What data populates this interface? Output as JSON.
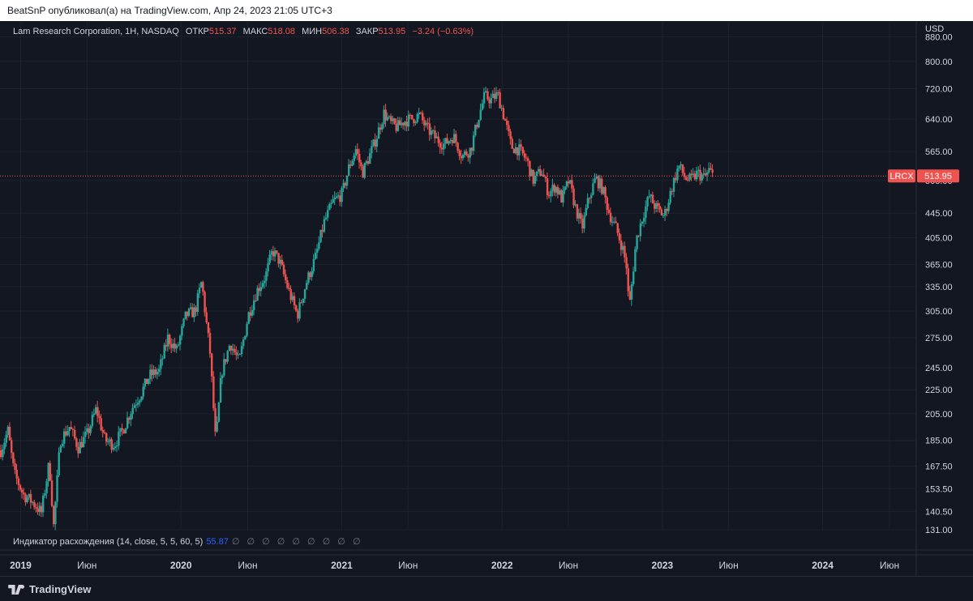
{
  "header": {
    "publisher_text": "BeatSnP опубликовал(а) на TradingView.com, Апр 24, 2023 21:05 UTC+3"
  },
  "legend": {
    "title": "Lam Research Corporation, 1H, NASDAQ",
    "open_label": "ОТКР",
    "open_value": "515.37",
    "high_label": "МАКС",
    "high_value": "518.08",
    "low_label": "МИН",
    "low_value": "506.38",
    "close_label": "ЗАКР",
    "close_value": "513.95",
    "change": "−3.24 (−0.63%)"
  },
  "indicator": {
    "label": "Индикатор расхождения (14, close, 5, 5, 60, 5)",
    "value": "55.87",
    "empty_values": "∅ ∅ ∅ ∅ ∅ ∅ ∅ ∅ ∅"
  },
  "price_scale": {
    "currency": "USD"
  },
  "footer": {
    "brand": "TradingView"
  },
  "colors": {
    "up": "#26a69a",
    "down": "#ef5350",
    "background": "#131722",
    "grid": "#1e222d",
    "price_line": "#f0524f",
    "text": "#d1d4dc"
  },
  "chart_data": {
    "type": "candlestick",
    "symbol": "LRCX",
    "y_scale": "log",
    "ylim": [
      131,
      935
    ],
    "x_range": [
      "2018-11-15",
      "2024-08-01"
    ],
    "y_ticks": [
      "880.00",
      "800.00",
      "720.00",
      "640.00",
      "565.00",
      "505.00",
      "445.00",
      "405.00",
      "365.00",
      "335.00",
      "305.00",
      "275.00",
      "245.00",
      "225.00",
      "205.00",
      "185.00",
      "167.50",
      "153.50",
      "140.50",
      "131.00"
    ],
    "x_ticks": [
      {
        "date": "2019-01-01",
        "label": "2019",
        "bold": true
      },
      {
        "date": "2019-06-01",
        "label": "Июн",
        "bold": false
      },
      {
        "date": "2020-01-01",
        "label": "2020",
        "bold": true
      },
      {
        "date": "2020-06-01",
        "label": "Июн",
        "bold": false
      },
      {
        "date": "2021-01-01",
        "label": "2021",
        "bold": true
      },
      {
        "date": "2021-06-01",
        "label": "Июн",
        "bold": false
      },
      {
        "date": "2022-01-01",
        "label": "2022",
        "bold": true
      },
      {
        "date": "2022-06-01",
        "label": "Июн",
        "bold": false
      },
      {
        "date": "2023-01-01",
        "label": "2023",
        "bold": true
      },
      {
        "date": "2023-06-01",
        "label": "Июн",
        "bold": false
      },
      {
        "date": "2024-01-01",
        "label": "2024",
        "bold": true
      },
      {
        "date": "2024-06-01",
        "label": "Июн",
        "bold": false
      }
    ],
    "last_price": {
      "label": "LRCX",
      "value": 513.95
    },
    "close_path": [
      [
        "2018-11-15",
        178
      ],
      [
        "2018-12-01",
        192
      ],
      [
        "2018-12-15",
        163
      ],
      [
        "2019-01-05",
        150
      ],
      [
        "2019-01-25",
        146
      ],
      [
        "2019-02-15",
        140
      ],
      [
        "2019-03-05",
        170
      ],
      [
        "2019-03-15",
        133
      ],
      [
        "2019-03-30",
        185
      ],
      [
        "2019-04-20",
        195
      ],
      [
        "2019-05-10",
        180
      ],
      [
        "2019-05-31",
        190
      ],
      [
        "2019-06-20",
        209
      ],
      [
        "2019-07-10",
        185
      ],
      [
        "2019-07-31",
        182
      ],
      [
        "2019-08-20",
        193
      ],
      [
        "2019-09-10",
        210
      ],
      [
        "2019-09-30",
        222
      ],
      [
        "2019-10-20",
        238
      ],
      [
        "2019-11-10",
        242
      ],
      [
        "2019-11-30",
        275
      ],
      [
        "2019-12-20",
        262
      ],
      [
        "2020-01-10",
        300
      ],
      [
        "2020-01-31",
        305
      ],
      [
        "2020-02-15",
        342
      ],
      [
        "2020-02-24",
        298
      ],
      [
        "2020-03-05",
        260
      ],
      [
        "2020-03-18",
        183
      ],
      [
        "2020-03-31",
        240
      ],
      [
        "2020-04-20",
        270
      ],
      [
        "2020-05-10",
        250
      ],
      [
        "2020-05-31",
        300
      ],
      [
        "2020-06-20",
        330
      ],
      [
        "2020-07-10",
        350
      ],
      [
        "2020-07-25",
        385
      ],
      [
        "2020-08-10",
        370
      ],
      [
        "2020-08-31",
        330
      ],
      [
        "2020-09-20",
        300
      ],
      [
        "2020-10-10",
        340
      ],
      [
        "2020-10-31",
        375
      ],
      [
        "2020-11-20",
        430
      ],
      [
        "2020-12-10",
        465
      ],
      [
        "2020-12-31",
        480
      ],
      [
        "2021-01-15",
        530
      ],
      [
        "2021-01-31",
        570
      ],
      [
        "2021-02-15",
        520
      ],
      [
        "2021-03-05",
        560
      ],
      [
        "2021-03-20",
        600
      ],
      [
        "2021-04-05",
        655
      ],
      [
        "2021-04-20",
        630
      ],
      [
        "2021-05-05",
        620
      ],
      [
        "2021-05-20",
        635
      ],
      [
        "2021-06-05",
        640
      ],
      [
        "2021-06-25",
        650
      ],
      [
        "2021-07-10",
        620
      ],
      [
        "2021-07-31",
        595
      ],
      [
        "2021-08-20",
        580
      ],
      [
        "2021-09-10",
        600
      ],
      [
        "2021-09-30",
        555
      ],
      [
        "2021-10-20",
        570
      ],
      [
        "2021-11-05",
        640
      ],
      [
        "2021-11-20",
        700
      ],
      [
        "2021-12-05",
        690
      ],
      [
        "2021-12-20",
        705
      ],
      [
        "2022-01-05",
        640
      ],
      [
        "2022-01-20",
        575
      ],
      [
        "2022-02-05",
        570
      ],
      [
        "2022-02-25",
        545
      ],
      [
        "2022-03-10",
        505
      ],
      [
        "2022-03-30",
        525
      ],
      [
        "2022-04-15",
        480
      ],
      [
        "2022-04-30",
        495
      ],
      [
        "2022-05-15",
        470
      ],
      [
        "2022-05-31",
        505
      ],
      [
        "2022-06-15",
        455
      ],
      [
        "2022-06-30",
        420
      ],
      [
        "2022-07-15",
        470
      ],
      [
        "2022-07-31",
        510
      ],
      [
        "2022-08-15",
        490
      ],
      [
        "2022-08-31",
        445
      ],
      [
        "2022-09-15",
        420
      ],
      [
        "2022-09-30",
        390
      ],
      [
        "2022-10-10",
        360
      ],
      [
        "2022-10-15",
        305
      ],
      [
        "2022-10-31",
        400
      ],
      [
        "2022-11-15",
        440
      ],
      [
        "2022-11-30",
        475
      ],
      [
        "2022-12-15",
        455
      ],
      [
        "2023-01-03",
        440
      ],
      [
        "2023-01-20",
        490
      ],
      [
        "2023-02-05",
        535
      ],
      [
        "2023-02-20",
        510
      ],
      [
        "2023-03-05",
        505
      ],
      [
        "2023-03-20",
        520
      ],
      [
        "2023-04-05",
        510
      ],
      [
        "2023-04-15",
        525
      ],
      [
        "2023-04-24",
        514
      ]
    ]
  }
}
